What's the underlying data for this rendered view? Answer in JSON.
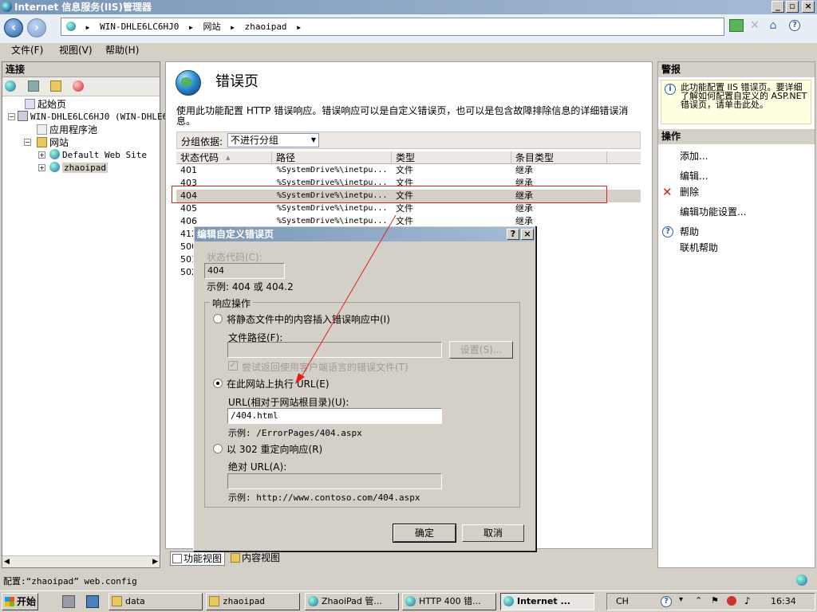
{
  "window": {
    "title": "Internet 信息服务(IIS)管理器"
  },
  "address": {
    "crumbs": [
      "WIN-DHLE6LC6HJ0",
      "网站",
      "zhaoipad"
    ]
  },
  "menu": {
    "file": "文件(F)",
    "view": "视图(V)",
    "help": "帮助(H)"
  },
  "connections": {
    "header": "连接",
    "tree": {
      "start": "起始页",
      "server": "WIN-DHLE6LC6HJ0 (WIN-DHLE6",
      "apppools": "应用程序池",
      "sites": "网站",
      "default_site": "Default Web Site",
      "zhaoipad": "zhaoipad"
    }
  },
  "main": {
    "title": "错误页",
    "description": "使用此功能配置 HTTP 错误响应。错误响应可以是自定义错误页，也可以是包含故障排除信息的详细错误消息。",
    "group_label": "分组依据:",
    "group_value": "不进行分组",
    "columns": [
      "状态代码",
      "路径",
      "类型",
      "条目类型"
    ],
    "rows": [
      {
        "code": "401",
        "path": "%SystemDrive%\\inetpu...",
        "type": "文件",
        "entry": "继承"
      },
      {
        "code": "403",
        "path": "%SystemDrive%\\inetpu...",
        "type": "文件",
        "entry": "继承"
      },
      {
        "code": "404",
        "path": "%SystemDrive%\\inetpu...",
        "type": "文件",
        "entry": "继承"
      },
      {
        "code": "405",
        "path": "%SystemDrive%\\inetpu...",
        "type": "文件",
        "entry": "继承"
      },
      {
        "code": "406",
        "path": "%SystemDrive%\\inetpu...",
        "type": "文件",
        "entry": "继承"
      },
      {
        "code": "412",
        "path": "",
        "type": "",
        "entry": ""
      },
      {
        "code": "500",
        "path": "",
        "type": "",
        "entry": ""
      },
      {
        "code": "501",
        "path": "",
        "type": "",
        "entry": ""
      },
      {
        "code": "502",
        "path": "",
        "type": "",
        "entry": ""
      }
    ],
    "view_tabs": {
      "features": "功能视图",
      "content": "内容视图"
    }
  },
  "alerts": {
    "header": "警报",
    "text": "此功能配置 IIS 错误页。要详细了解如何配置自定义的 ASP.NET 错误页，请单击此处。"
  },
  "actions": {
    "header": "操作",
    "add": "添加...",
    "edit": "编辑...",
    "delete": "删除",
    "edit_feature": "编辑功能设置...",
    "help": "帮助",
    "online_help": "联机帮助"
  },
  "dialog": {
    "title": "编辑自定义错误页",
    "help_btn": "?",
    "close_btn": "×",
    "status_label": "状态代码(C):",
    "status_value": "404",
    "status_example": "示例: 404 或 404.2",
    "group_legend": "响应操作",
    "opt_static": "将静态文件中的内容插入错误响应中(I)",
    "file_path_label": "文件路径(F):",
    "settings_btn": "设置(S)...",
    "try_lang": "尝试返回使用客户端语言的错误文件(T)",
    "opt_url": "在此网站上执行 URL(E)",
    "url_label": "URL(相对于网站根目录)(U):",
    "url_value": "/404.html",
    "url_example": "示例: /ErrorPages/404.aspx",
    "opt_redirect": "以 302 重定向响应(R)",
    "abs_label": "绝对 URL(A):",
    "abs_example": "示例: http://www.contoso.com/404.aspx",
    "ok": "确定",
    "cancel": "取消"
  },
  "status": {
    "text": "配置:“zhaoipad” web.config"
  },
  "taskbar": {
    "start": "开始",
    "tasks": [
      "data",
      "zhaoipad",
      "ZhaoiPad 管...",
      "HTTP 400 错...",
      "Internet ..."
    ],
    "lang": "CH",
    "time": "16:34"
  }
}
